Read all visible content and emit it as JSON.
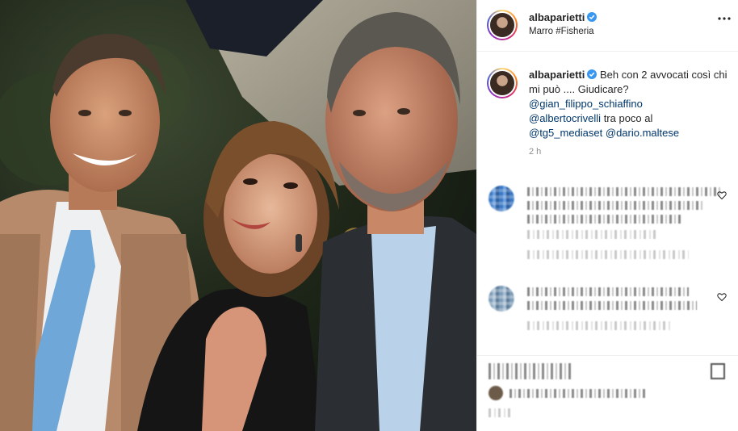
{
  "photo": {
    "description_icon": "photo-of-three-people",
    "colors": {
      "background_foliage": "#25301f",
      "jacket_tan": "#b78a6c",
      "tie_blue": "#6fa7d8",
      "dress_black": "#151515",
      "jacket_dark": "#2b2e33",
      "shirt_lightblue": "#b9d2ea"
    }
  },
  "header": {
    "username": "albaparietti",
    "location": "Marro #Fisheria",
    "verified_icon": "verified-badge-icon",
    "more_icon": "more-options-icon"
  },
  "caption": {
    "username": "albaparietti",
    "text": "Beh con 2 avvocati così chi mi può .... Giudicare?",
    "mention_1": "@gian_filippo_schiaffino",
    "mention_2": "@albertocrivelli",
    "text_2": "tra poco al",
    "mention_3": "@tg5_mediaset",
    "mention_4": "@dario.maltese",
    "time": "2 h"
  },
  "colors": {
    "link": "#00376b",
    "verified": "#3897f0",
    "muted": "#8e8e8e",
    "border": "#efefef"
  }
}
